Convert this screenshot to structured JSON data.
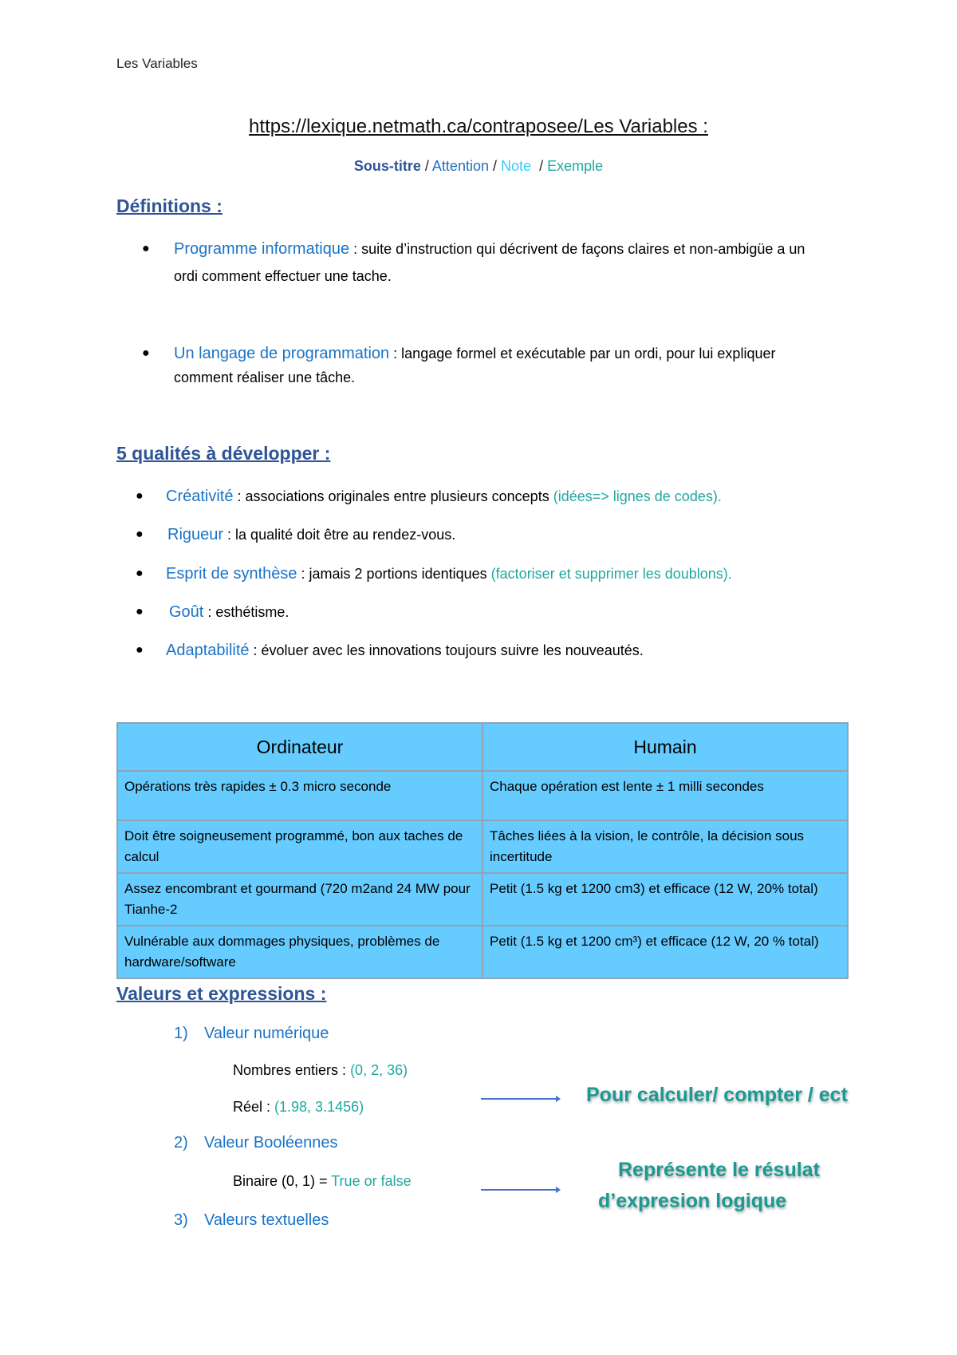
{
  "header": {
    "running_title": "Les Variables"
  },
  "title": "https://lexique.netmath.ca/contraposee/Les Variables :",
  "legend": {
    "subtitle": "Sous-titre",
    "attention": "Attention",
    "note": "Note",
    "example": "Exemple",
    "separator": "/"
  },
  "definitions": {
    "heading": "Définitions :",
    "items": [
      {
        "term": "Programme informatique",
        "text": " : suite d’instruction qui décrivent de façons claires et non-ambigüe a un ordi comment effectuer une tache."
      },
      {
        "term": "Un langage de programmation",
        "text": " : langage formel et exécutable par un ordi, pour lui expliquer comment réaliser une tâche."
      }
    ]
  },
  "qualities": {
    "heading": "5 qualités à développer :",
    "items": [
      {
        "term": "Créativité",
        "text": " : associations originales entre plusieurs concepts ",
        "example": "(idées=> lignes de codes)."
      },
      {
        "term": "Rigueur",
        "text": " : la qualité doit être au rendez-vous.",
        "example": ""
      },
      {
        "term": "Esprit de synthèse",
        "text": " : jamais 2 portions identiques ",
        "example": "(factoriser et supprimer les doublons)."
      },
      {
        "term": "Goût",
        "text": " : esthétisme.",
        "example": ""
      },
      {
        "term": "Adaptabilité",
        "text": " : évoluer avec les innovations toujours suivre les nouveautés.",
        "example": ""
      }
    ]
  },
  "comparison_table": {
    "headers": [
      "Ordinateur",
      "Humain"
    ],
    "rows": [
      [
        "Opérations très rapides ± 0.3 micro seconde",
        "Chaque opération est lente ± 1 milli secondes"
      ],
      [
        "Doit être soigneusement programmé, bon aux taches de calcul",
        "Tâches liées à la vision, le contrôle, la décision sous incertitude"
      ],
      [
        "Assez encombrant et gourmand (720 m2and 24 MW pour Tianhe-2",
        "Petit (1.5 kg et 1200 cm3) et efficace (12 W, 20% total)"
      ],
      [
        "Vulnérable aux dommages physiques, problèmes de hardware/software",
        "Petit (1.5 kg et 1200 cm³) et efficace (12 W, 20 % total)"
      ]
    ]
  },
  "values": {
    "heading": "Valeurs et expressions :",
    "sections": [
      {
        "number": "1)",
        "title": "Valeur numérique",
        "lines": [
          {
            "label": "Nombres entiers : ",
            "example": "(0, 2, 36)"
          },
          {
            "label": "Réel : ",
            "example": "(1.98, 3.1456)"
          }
        ]
      },
      {
        "number": "2)",
        "title": "Valeur Booléennes",
        "lines": [
          {
            "label": "Binaire (0, 1) = ",
            "example": "True or false"
          }
        ]
      },
      {
        "number": "3)",
        "title": "Valeurs textuelles",
        "lines": []
      }
    ],
    "notes": {
      "numeric": "Pour calculer/ compter / ect",
      "boolean_line1": "Représente le résulat",
      "boolean_line2": "d’expresion logique"
    }
  }
}
